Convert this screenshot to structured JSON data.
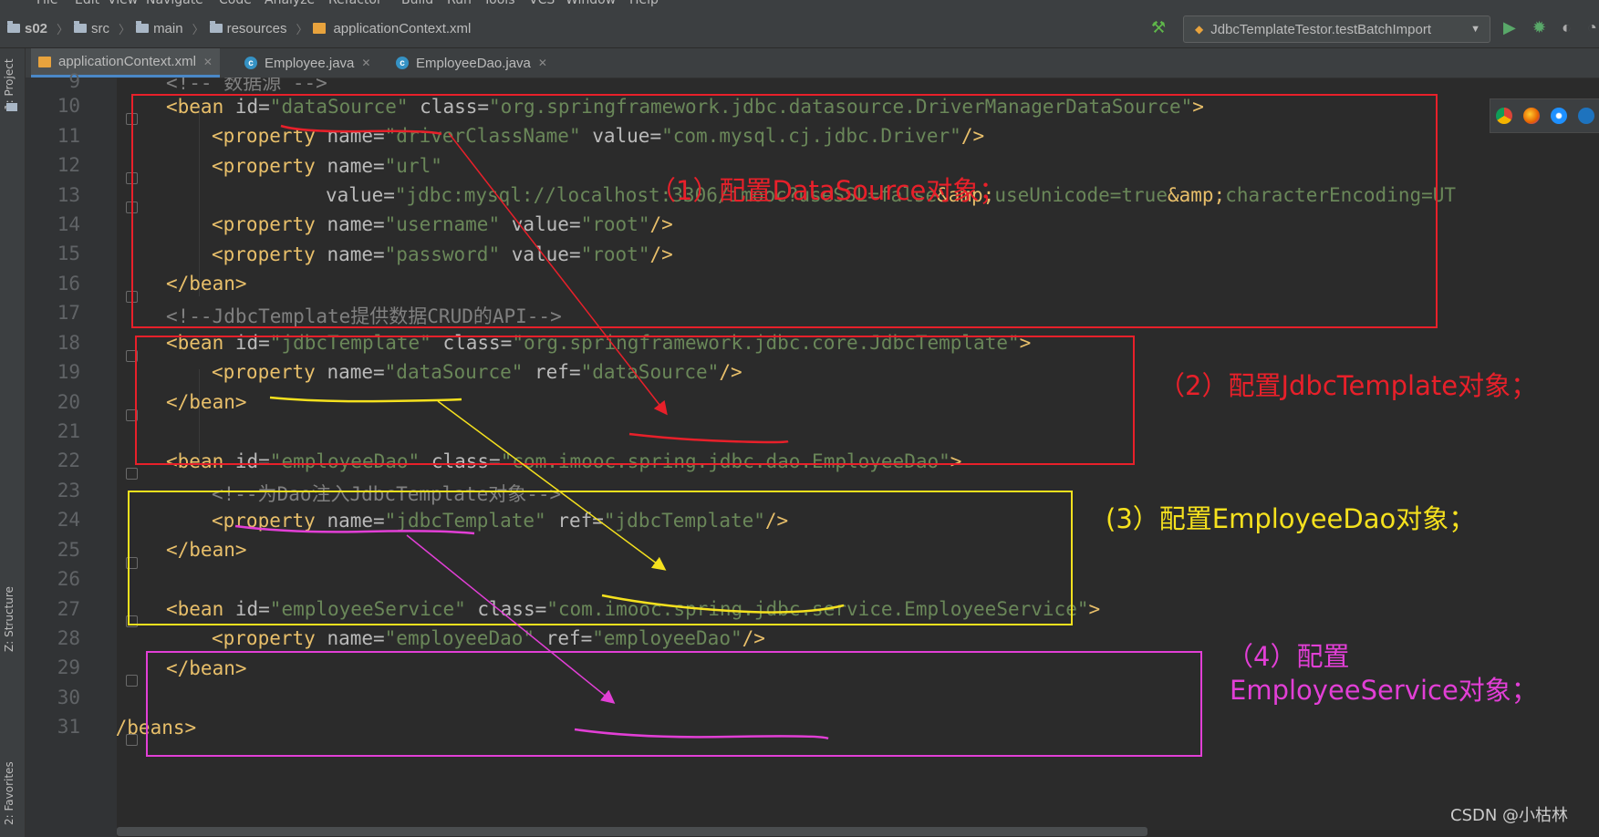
{
  "menu": [
    "File",
    "Edit",
    "View",
    "Navigate",
    "Code",
    "Analyze",
    "Refactor",
    "Build",
    "Run",
    "Tools",
    "VCS",
    "Window",
    "Help"
  ],
  "breadcrumb": [
    "s02",
    "src",
    "main",
    "resources",
    "applicationContext.xml"
  ],
  "run_config": "JdbcTemplateTestor.testBatchImport",
  "tabs": [
    {
      "label": "applicationContext.xml",
      "active": true
    },
    {
      "label": "Employee.java",
      "active": false
    },
    {
      "label": "EmployeeDao.java",
      "active": false
    }
  ],
  "side_labels": [
    "1: Project",
    "Z: Structure",
    "2: Favorites"
  ],
  "line_numbers": [
    "9",
    "10",
    "11",
    "12",
    "13",
    "14",
    "15",
    "16",
    "17",
    "18",
    "19",
    "20",
    "21",
    "22",
    "23",
    "24",
    "25",
    "26",
    "27",
    "28",
    "29",
    "30",
    "31"
  ],
  "code": {
    "l9": {
      "cmt": "<!-- 数据源 -->"
    },
    "l10": {
      "t1": "<bean ",
      "a1": "id=",
      "v1": "\"dataSource\"",
      "a2": " class=",
      "v2": "\"org.springframework.jdbc.datasource.DriverManagerDataSource\"",
      "t2": ">"
    },
    "l11": {
      "t1": "<property ",
      "a1": "name=",
      "v1": "\"driverClassName\"",
      "a2": " value=",
      "v2": "\"com.mysql.cj.jdbc.Driver\"",
      "t2": "/>"
    },
    "l12": {
      "t1": "<property ",
      "a1": "name=",
      "v1": "\"url\""
    },
    "l13": {
      "a1": "value=",
      "v1": "\"jdbc:mysql://localhost:3306/imooc?useSSL=false",
      "t1": "&amp;",
      "v2": "useUnicode=true",
      "t2": "&amp;",
      "v3": "characterEncoding=UT"
    },
    "l14": {
      "t1": "<property ",
      "a1": "name=",
      "v1": "\"username\"",
      "a2": " value=",
      "v2": "\"root\"",
      "t2": "/>"
    },
    "l15": {
      "t1": "<property ",
      "a1": "name=",
      "v1": "\"password\"",
      "a2": " value=",
      "v2": "\"root\"",
      "t2": "/>"
    },
    "l16": {
      "t1": "</bean>"
    },
    "l17": {
      "cmt": "<!--JdbcTemplate提供数据CRUD的API-->"
    },
    "l18": {
      "t1": "<bean ",
      "a1": "id=",
      "v1": "\"jdbcTemplate\"",
      "a2": " class=",
      "v2": "\"org.springframework.jdbc.core.JdbcTemplate\"",
      "t2": ">"
    },
    "l19": {
      "t1": "<property ",
      "a1": "name=",
      "v1": "\"dataSource\"",
      "a2": " ref=",
      "v2": "\"dataSource\"",
      "t2": "/>"
    },
    "l20": {
      "t1": "</bean>"
    },
    "l22": {
      "t1": "<bean ",
      "a1": "id=",
      "v1": "\"employeeDao\"",
      "a2": " class=",
      "v2": "\"com.imooc.spring.jdbc.dao.EmployeeDao\"",
      "t2": ">"
    },
    "l23": {
      "cmt": "<!--为Dao注入JdbcTemplate对象-->"
    },
    "l24": {
      "t1": "<property ",
      "a1": "name=",
      "v1": "\"jdbcTemplate\"",
      "a2": " ref=",
      "v2": "\"jdbcTemplate\"",
      "t2": "/>"
    },
    "l25": {
      "t1": "</bean>"
    },
    "l27": {
      "t1": "<bean ",
      "a1": "id=",
      "v1": "\"employeeService\"",
      "a2": " class=",
      "v2": "\"com.imooc.spring.jdbc.service.EmployeeService\"",
      "t2": ">"
    },
    "l28": {
      "t1": "<property ",
      "a1": "name=",
      "v1": "\"employeeDao\"",
      "a2": " ref=",
      "v2": "\"employeeDao\"",
      "t2": "/>"
    },
    "l29": {
      "t1": "</bean>"
    },
    "l31": {
      "t1": "</beans>"
    }
  },
  "annotations": {
    "a1": "（1）配置DataSource对象；",
    "a2": "（2）配置JdbcTemplate对象；",
    "a3": "(3）配置EmployeeDao对象；",
    "a4_line1": "（4）配置",
    "a4_line2": "EmployeeService对象；"
  },
  "colors": {
    "red": "#e8202a",
    "yellow": "#f5e11e",
    "magenta": "#e23fd6",
    "arrow_red": "#e8202a",
    "arrow_yellow": "#f5e11e",
    "arrow_magenta": "#e23fd6"
  },
  "watermark": "CSDN @小枯林"
}
